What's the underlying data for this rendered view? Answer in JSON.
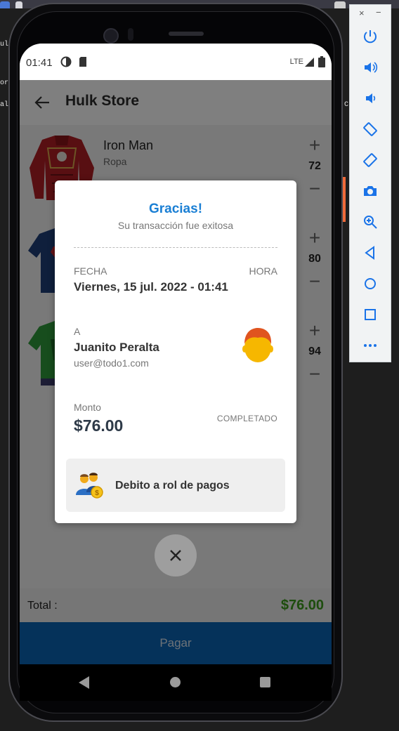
{
  "desktop": {
    "left_fragment_1": "ul",
    "left_fragment_2": "or",
    "left_fragment_3": "al",
    "right_fragment": "C  -n"
  },
  "statusbar": {
    "time": "01:41",
    "network": "LTE"
  },
  "appbar": {
    "title": "Hulk Store"
  },
  "products": [
    {
      "name": "Iron Man",
      "category": "Ropa",
      "quantity": "72"
    },
    {
      "name": "",
      "category": "",
      "quantity": "80"
    },
    {
      "name": "",
      "category": "",
      "quantity": "94"
    }
  ],
  "total": {
    "label": "Total :",
    "value": "$76.00"
  },
  "pay_button": {
    "label": "Pagar"
  },
  "dialog": {
    "title": "Gracias!",
    "subtitle": "Su transacción fue exitosa",
    "date_label": "FECHA",
    "time_label": "HORA",
    "date_value": "Viernes, 15 jul. 2022 - 01:41",
    "to_label": "A",
    "recipient_name": "Juanito Peralta",
    "recipient_email": "user@todo1.com",
    "amount_label": "Monto",
    "amount_value": "$76.00",
    "status": "COMPLETADO",
    "method": "Debito a rol de pagos"
  },
  "colors": {
    "accent_blue": "#1a7fd4",
    "pay_blue": "#0a64b4",
    "total_green": "#3a9a1a"
  },
  "emulator_panel": {
    "icons": [
      "power-icon",
      "volume-up-icon",
      "volume-down-icon",
      "rotate-left-icon",
      "rotate-right-icon",
      "camera-icon",
      "zoom-icon",
      "back-icon",
      "home-icon",
      "overview-icon",
      "more-icon"
    ]
  }
}
